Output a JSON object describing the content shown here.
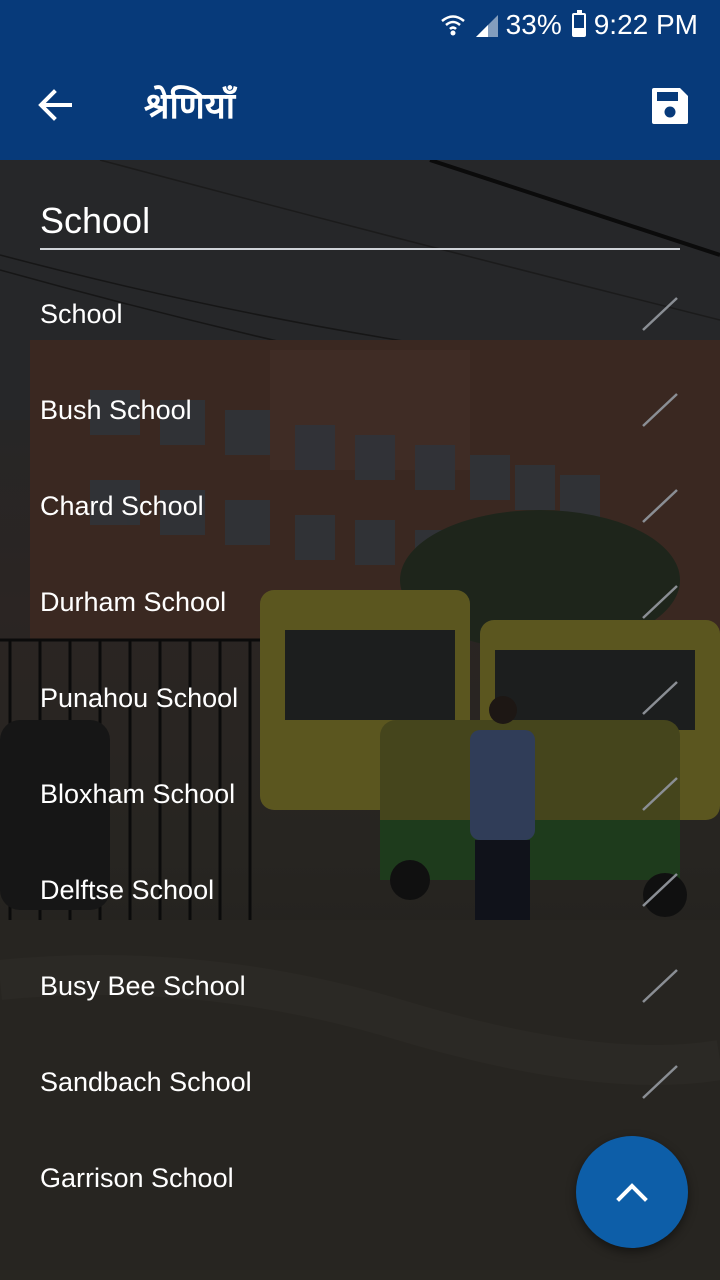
{
  "status_bar": {
    "battery": "33%",
    "time": "9:22 PM"
  },
  "app_bar": {
    "title": "श्रेणियाँ",
    "back_icon": "arrow-back-icon",
    "save_icon": "save-icon"
  },
  "search": {
    "value": "School"
  },
  "categories": [
    "School",
    "Bush School",
    "Chard School",
    "Durham School",
    "Punahou School",
    "Bloxham School",
    "Delftse School",
    "Busy Bee School",
    "Sandbach School",
    "Garrison School"
  ],
  "fab": {
    "icon": "chevron-up-icon"
  },
  "colors": {
    "primary": "#073a7a",
    "fab": "#0d5ea8",
    "text": "#ffffff"
  }
}
